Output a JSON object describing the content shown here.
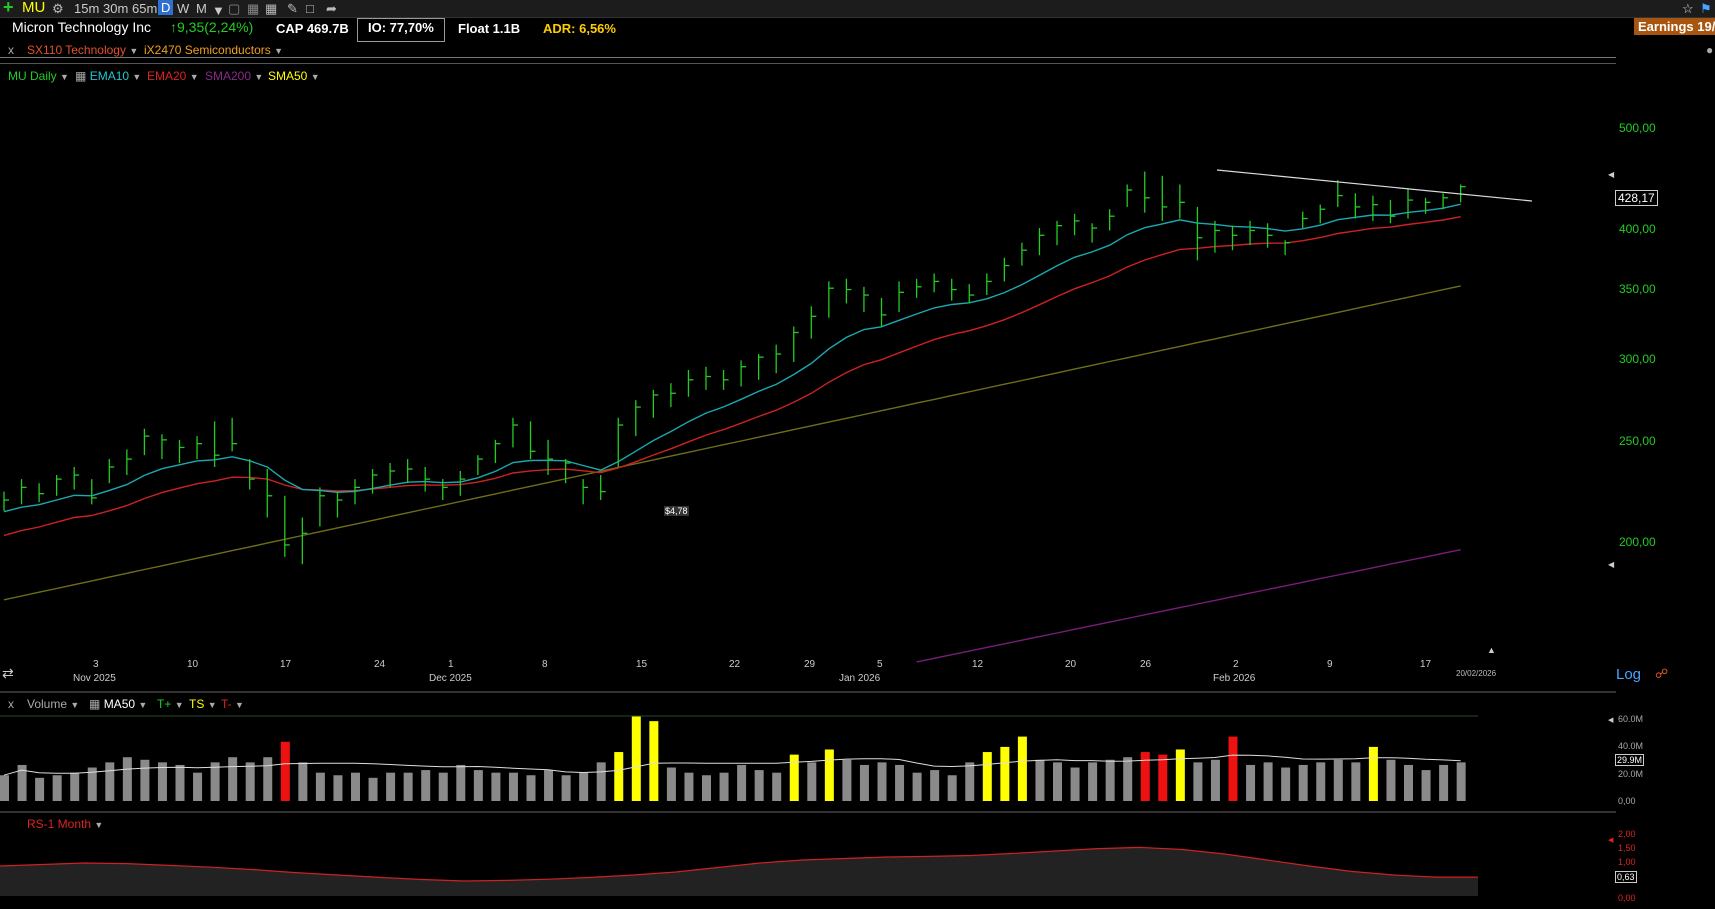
{
  "toolbar": {
    "add_icon": "plus-icon",
    "symbol": "MU",
    "timeframes": [
      "15m",
      "30m",
      "65m"
    ],
    "active_tf": "D",
    "tf_w": "W",
    "tf_m": "M"
  },
  "info": {
    "company": "Micron Technology Inc",
    "change": "↑9,35(2,24%)",
    "cap": "CAP 469.7B",
    "io": "IO: 77,70%",
    "float": "Float 1.1B",
    "adr": "ADR: 6,56%",
    "earnings": "Earnings 19/"
  },
  "sectors": {
    "close_x": "x",
    "sector": "SX110 Technology",
    "industry": "iX2470 Semiconductors"
  },
  "legend": {
    "main": "MU Daily",
    "ema10": "EMA10",
    "ema20": "EMA20",
    "sma200": "SMA200",
    "sma50": "SMA50"
  },
  "colors": {
    "green": "#22cc22",
    "ema10": "#1aa9b0",
    "ema20": "#cc2222",
    "sma50": "#6e6e1a",
    "sma200": "#7a1d7a",
    "yellow": "#ffff00"
  },
  "price_axis": {
    "ticks": [
      "500,00",
      "400,00",
      "350,00",
      "300,00",
      "250,00",
      "200,00"
    ],
    "current": "428,17",
    "log_label": "Log"
  },
  "annotation": "$4,78",
  "date_axis": {
    "labels": [
      "3",
      "10",
      "17",
      "24",
      "1",
      "8",
      "15",
      "22",
      "29",
      "5",
      "12",
      "20",
      "26",
      "2",
      "9",
      "17"
    ],
    "months": [
      "Nov 2025",
      "Dec 2025",
      "Jan 2026",
      "Feb 2026"
    ],
    "last_date": "20/02/2026"
  },
  "volume_panel": {
    "close_x": "x",
    "label": "Volume",
    "ma": "MA50",
    "tplus": "T+",
    "ts": "TS",
    "tminus": "T-",
    "ticks": [
      "60.0M",
      "40.0M",
      "20.0M",
      "0,00"
    ],
    "current": "29.9M"
  },
  "rs_panel": {
    "label": "RS-1 Month",
    "ticks": [
      "2,00",
      "1,50",
      "1,00",
      "0,00"
    ],
    "current": "0,63"
  },
  "chart_data": {
    "type": "ohlc",
    "log_scale": true,
    "ylim": [
      160,
      520
    ],
    "bars_hlc": [
      [
        224,
        215,
        220
      ],
      [
        230,
        218,
        226
      ],
      [
        228,
        219,
        223
      ],
      [
        232,
        222,
        230
      ],
      [
        236,
        225,
        232
      ],
      [
        230,
        218,
        221
      ],
      [
        240,
        228,
        236
      ],
      [
        245,
        232,
        240
      ],
      [
        256,
        242,
        252
      ],
      [
        253,
        240,
        250
      ],
      [
        250,
        238,
        246
      ],
      [
        252,
        240,
        248
      ],
      [
        260,
        236,
        242
      ],
      [
        262,
        244,
        248
      ],
      [
        240,
        225,
        230
      ],
      [
        235,
        212,
        222
      ],
      [
        222,
        195,
        200
      ],
      [
        212,
        192,
        205
      ],
      [
        226,
        208,
        222
      ],
      [
        224,
        212,
        220
      ],
      [
        230,
        218,
        226
      ],
      [
        235,
        223,
        232
      ],
      [
        238,
        226,
        234
      ],
      [
        240,
        228,
        235
      ],
      [
        236,
        224,
        230
      ],
      [
        230,
        220,
        226
      ],
      [
        234,
        222,
        230
      ],
      [
        242,
        232,
        240
      ],
      [
        250,
        238,
        248
      ],
      [
        262,
        246,
        258
      ],
      [
        260,
        240,
        244
      ],
      [
        250,
        232,
        240
      ],
      [
        240,
        228,
        238
      ],
      [
        230,
        218,
        226
      ],
      [
        232,
        220,
        224
      ],
      [
        262,
        236,
        258
      ],
      [
        272,
        252,
        268
      ],
      [
        278,
        262,
        275
      ],
      [
        282,
        268,
        276
      ],
      [
        290,
        274,
        284
      ],
      [
        292,
        278,
        286
      ],
      [
        290,
        278,
        284
      ],
      [
        296,
        280,
        292
      ],
      [
        300,
        284,
        298
      ],
      [
        306,
        288,
        300
      ],
      [
        318,
        295,
        314
      ],
      [
        332,
        310,
        325
      ],
      [
        350,
        324,
        345
      ],
      [
        352,
        334,
        344
      ],
      [
        346,
        328,
        340
      ],
      [
        338,
        318,
        326
      ],
      [
        350,
        328,
        342
      ],
      [
        352,
        338,
        346
      ],
      [
        356,
        342,
        350
      ],
      [
        352,
        336,
        344
      ],
      [
        348,
        334,
        340
      ],
      [
        356,
        340,
        350
      ],
      [
        368,
        350,
        362
      ],
      [
        380,
        362,
        374
      ],
      [
        392,
        370,
        386
      ],
      [
        398,
        378,
        394
      ],
      [
        404,
        386,
        398
      ],
      [
        396,
        380,
        392
      ],
      [
        408,
        390,
        402
      ],
      [
        430,
        410,
        425
      ],
      [
        442,
        405,
        418
      ],
      [
        438,
        398,
        410
      ],
      [
        430,
        400,
        414
      ],
      [
        410,
        366,
        384
      ],
      [
        398,
        372,
        390
      ],
      [
        394,
        374,
        386
      ],
      [
        398,
        378,
        390
      ],
      [
        396,
        376,
        386
      ],
      [
        382,
        370,
        380
      ],
      [
        406,
        392,
        400
      ],
      [
        412,
        396,
        408
      ],
      [
        434,
        410,
        420
      ],
      [
        422,
        400,
        410
      ],
      [
        420,
        398,
        412
      ],
      [
        416,
        396,
        402
      ],
      [
        426,
        400,
        416
      ],
      [
        418,
        404,
        414
      ],
      [
        422,
        408,
        418
      ],
      [
        430,
        414,
        428
      ]
    ],
    "sma200_range": [
      156,
      198
    ],
    "volume_millions": [
      20,
      28,
      18,
      20,
      22,
      26,
      30,
      34,
      32,
      30,
      28,
      22,
      30,
      34,
      30,
      34,
      46,
      30,
      22,
      20,
      22,
      18,
      22,
      22,
      24,
      22,
      28,
      24,
      22,
      22,
      20,
      24,
      20,
      22,
      30,
      38,
      66,
      62,
      26,
      22,
      20,
      22,
      28,
      24,
      22,
      36,
      30,
      40,
      32,
      28,
      30,
      28,
      22,
      24,
      20,
      30,
      38,
      42,
      50,
      32,
      30,
      26,
      30,
      32,
      34,
      38,
      36,
      40,
      30,
      32,
      50,
      28,
      30,
      26,
      28,
      30,
      32,
      30,
      42,
      32,
      28,
      24,
      28,
      30
    ],
    "rs_values": [
      1.0,
      1.05,
      1.1,
      1.08,
      1.02,
      0.96,
      0.88,
      0.78,
      0.7,
      0.62,
      0.55,
      0.5,
      0.52,
      0.56,
      0.62,
      0.7,
      0.8,
      0.95,
      1.1,
      1.2,
      1.25,
      1.3,
      1.32,
      1.35,
      1.42,
      1.5,
      1.58,
      1.62,
      1.55,
      1.4,
      1.2,
      1.0,
      0.82,
      0.7,
      0.63,
      0.63
    ]
  }
}
